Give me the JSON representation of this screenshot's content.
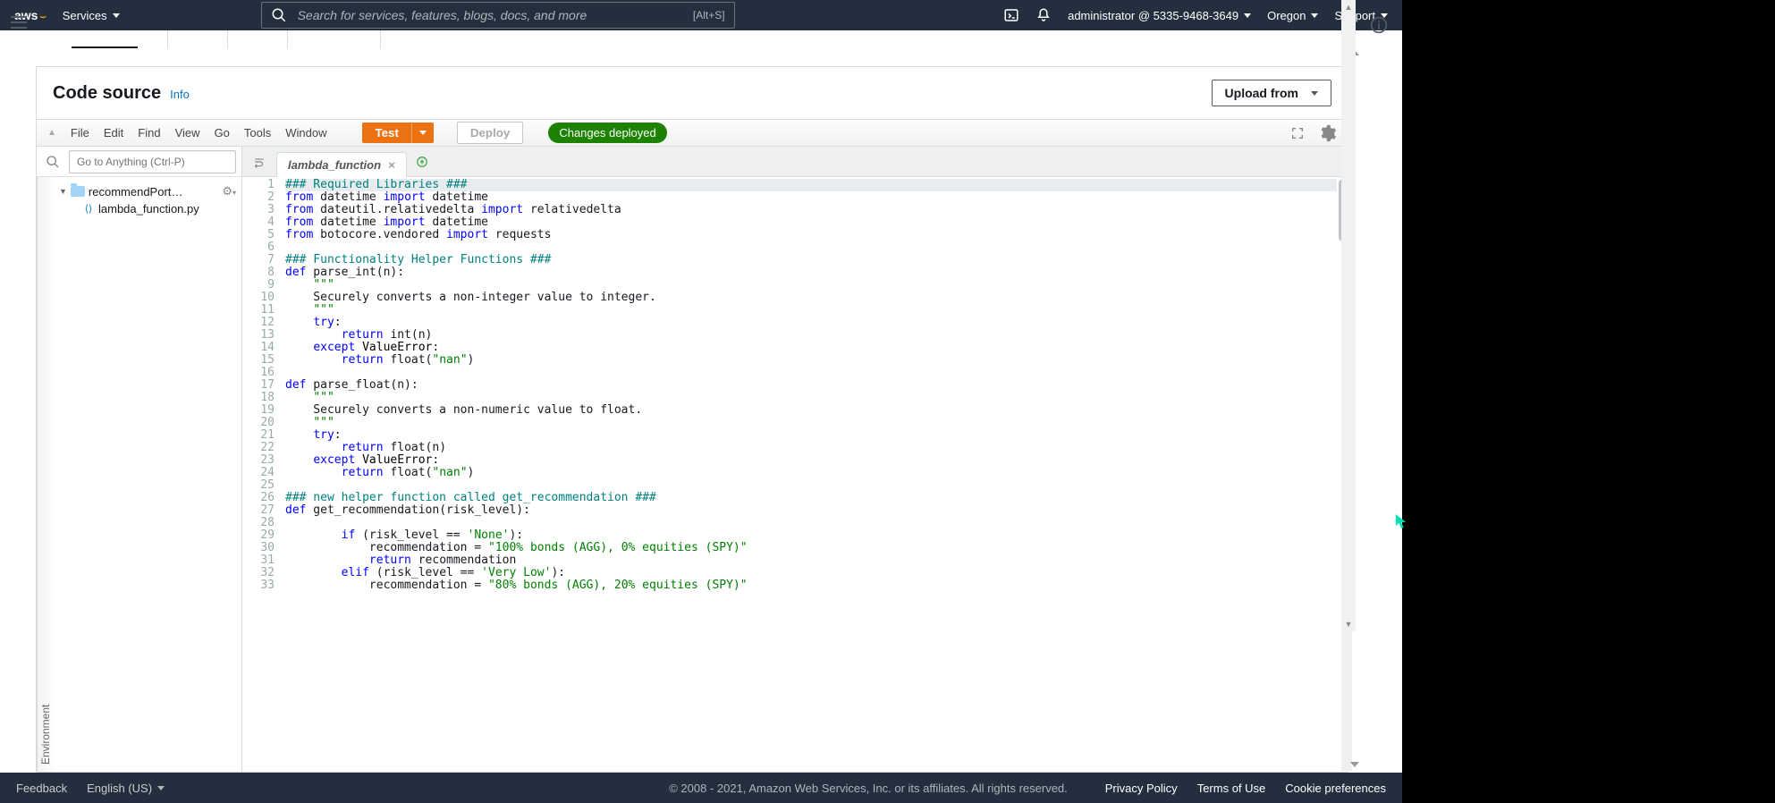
{
  "topbar": {
    "logo": "aws",
    "services": "Services",
    "search_placeholder": "Search for services, features, blogs, docs, and more",
    "search_kbd": "[Alt+S]",
    "account": "administrator @ 5335-9468-3649",
    "region": "Oregon",
    "support": "Support"
  },
  "panel": {
    "title": "Code source",
    "info": "Info",
    "upload": "Upload from"
  },
  "ide_menu": {
    "file": "File",
    "edit": "Edit",
    "find": "Find",
    "view": "View",
    "go": "Go",
    "tools": "Tools",
    "window": "Window",
    "test": "Test",
    "deploy": "Deploy",
    "deployed": "Changes deployed"
  },
  "ide_side": {
    "goto_placeholder": "Go to Anything (Ctrl-P)",
    "env_label": "Environment",
    "folder": "recommendPortfolio",
    "file": "lambda_function.py"
  },
  "editor": {
    "tab": "lambda_function",
    "lines": [
      "### Required Libraries ###",
      "from datetime import datetime",
      "from dateutil.relativedelta import relativedelta",
      "from datetime import datetime",
      "from botocore.vendored import requests",
      "",
      "### Functionality Helper Functions ###",
      "def parse_int(n):",
      "    \"\"\"",
      "    Securely converts a non-integer value to integer.",
      "    \"\"\"",
      "    try:",
      "        return int(n)",
      "    except ValueError:",
      "        return float(\"nan\")",
      "",
      "def parse_float(n):",
      "    \"\"\"",
      "    Securely converts a non-numeric value to float.",
      "    \"\"\"",
      "    try:",
      "        return float(n)",
      "    except ValueError:",
      "        return float(\"nan\")",
      "",
      "### new helper function called get_recommendation ###",
      "def get_recommendation(risk_level):",
      "",
      "        if (risk_level == 'None'):",
      "            recommendation = \"100% bonds (AGG), 0% equities (SPY)\"",
      "            return recommendation",
      "        elif (risk_level == 'Very Low'):",
      "            recommendation = \"80% bonds (AGG), 20% equities (SPY)\""
    ]
  },
  "footer": {
    "feedback": "Feedback",
    "lang": "English (US)",
    "copyright": "© 2008 - 2021, Amazon Web Services, Inc. or its affiliates. All rights reserved.",
    "privacy": "Privacy Policy",
    "terms": "Terms of Use",
    "cookies": "Cookie preferences"
  }
}
